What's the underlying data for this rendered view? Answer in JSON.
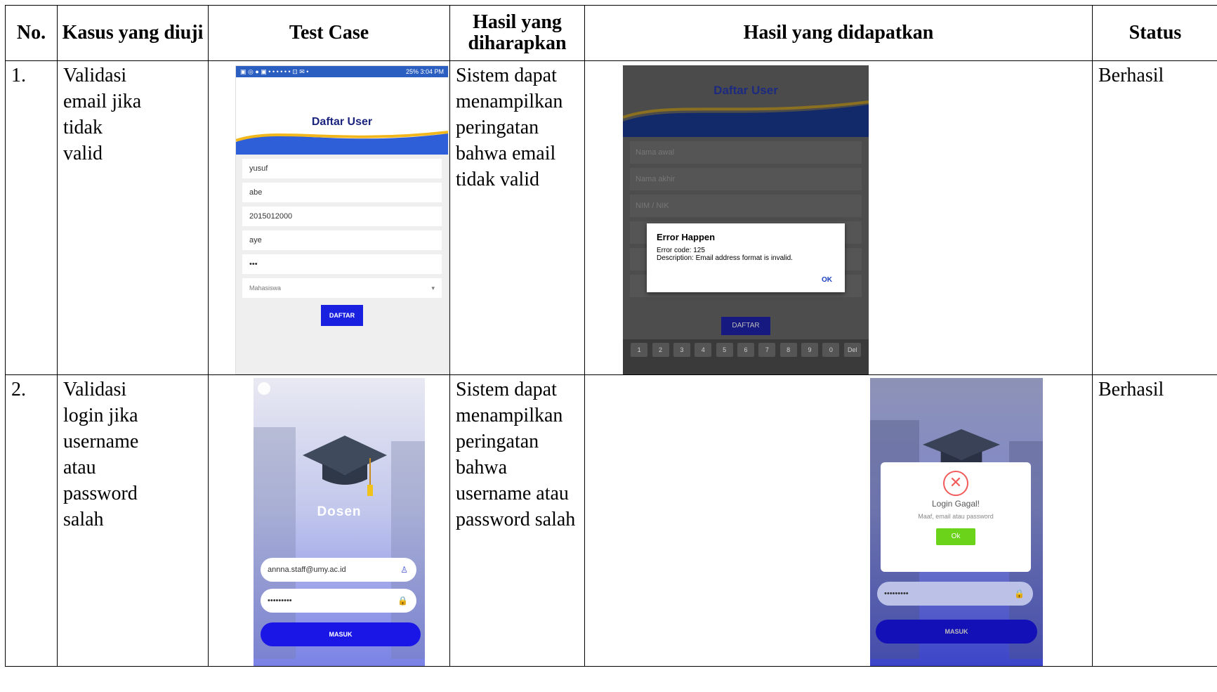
{
  "headers": {
    "no": "No.",
    "kasus": "Kasus yang diuji",
    "test_case": "Test Case",
    "harapan": "Hasil yang diharapkan",
    "didapatkan": "Hasil yang didapatkan",
    "status": "Status"
  },
  "rows": [
    {
      "no": "1.",
      "kasus_lines": [
        "Validasi",
        "email  jika",
        "tidak",
        "valid"
      ],
      "harapan_lines": [
        "Sistem  dapat",
        "menampilkan",
        "peringatan",
        "bahwa email",
        "tidak  valid"
      ],
      "status": "Berhasil"
    },
    {
      "no": "2.",
      "kasus_lines": [
        "Validasi",
        "login  jika",
        "username",
        "atau",
        "password",
        "salah"
      ],
      "harapan_lines": [
        "Sistem  dapat",
        "menampilkan",
        "peringatan",
        "bahwa",
        "username  atau",
        "password salah"
      ],
      "status": "Berhasil"
    }
  ],
  "register_screen": {
    "status_time": "25% 3:04 PM",
    "title": "Daftar User",
    "fields": [
      "yusuf",
      "abe",
      "2015012000",
      "aye",
      "•••"
    ],
    "select_value": "Mahasiswa",
    "button": "DAFTAR"
  },
  "register_error_screen": {
    "title": "Daftar User",
    "placeholders": [
      "Nama awal",
      "Nama akhir",
      "NIM / NIK"
    ],
    "dialog_title": "Error Happen",
    "dialog_line1": "Error code: 125",
    "dialog_line2": "Description: Email address format is invalid.",
    "dialog_ok": "OK",
    "button": "DAFTAR",
    "keys": [
      "1",
      "2",
      "3",
      "4",
      "5",
      "6",
      "7",
      "8",
      "9",
      "0",
      "Del"
    ]
  },
  "login_screen": {
    "role": "Dosen",
    "email": "annna.staff@umy.ac.id",
    "password": "•••••••••",
    "button": "MASUK"
  },
  "login_error_screen": {
    "dialog_title": "Login Gagal!",
    "dialog_text": "Maaf, email atau password",
    "dialog_ok": "Ok",
    "password": "•••••••••",
    "button": "MASUK"
  },
  "colors": {
    "daftar_button": "#1a20e0",
    "masuk_button": "#1a17e6",
    "ok_button": "#6ad31a",
    "error_icon": "#f25b5b"
  }
}
